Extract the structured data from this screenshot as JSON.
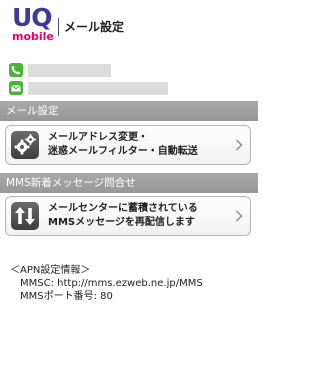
{
  "header": {
    "logo_uq": "UQ",
    "logo_mobile": "mobile",
    "title": "メール設定"
  },
  "contacts": [
    {
      "icon": "phone-icon"
    },
    {
      "icon": "mail-icon"
    }
  ],
  "sections": {
    "mail": {
      "title": "メール設定",
      "item": {
        "icon": "gears-icon",
        "line1": "メールアドレス変更・",
        "line2": "迷惑メールフィルター・自動転送"
      }
    },
    "mms": {
      "title": "MMS新着メッセージ問合せ",
      "item": {
        "icon": "resend-arrows-icon",
        "line1": "メールセンターに蓄積されている",
        "line2": "MMSメッセージを再配信します"
      }
    }
  },
  "apn": {
    "heading": "＜APN設定情報＞",
    "mmsc": "MMSC: http://mms.ezweb.ne.jp/MMS",
    "port": "MMSポート番号: 80"
  },
  "colors": {
    "logo_primary": "#3d3a99",
    "logo_accent": "#e5006e",
    "contact_icon": "#48b336",
    "section_header": "#a0a0a0"
  }
}
